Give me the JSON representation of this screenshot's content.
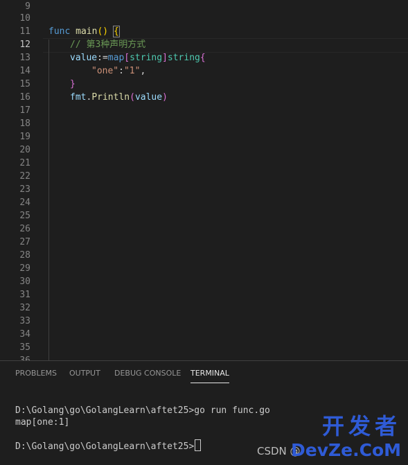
{
  "editor": {
    "line_numbers": [
      "9",
      "10",
      "11",
      "12",
      "13",
      "14",
      "15",
      "16",
      "17",
      "18",
      "19",
      "20",
      "21",
      "22",
      "23",
      "24",
      "25",
      "26",
      "27",
      "28",
      "29",
      "30",
      "31",
      "32",
      "33",
      "34",
      "35",
      "36"
    ],
    "current_line": "12",
    "code": {
      "l11": {
        "kw": "func",
        "fn": "main",
        "paren_open": "(",
        "paren_close": ")",
        "space": " ",
        "brace_open": "{"
      },
      "l12": {
        "comment": "// 第3种声明方式"
      },
      "l13": {
        "var": "value",
        "op": ":=",
        "kw": "map",
        "bo": "[",
        "t1": "string",
        "bc": "]",
        "t2": "string",
        "brace": "{"
      },
      "l14": {
        "s1": "\"one\"",
        "colon": ":",
        "s2": "\"1\"",
        "comma": ","
      },
      "l15": {
        "brace": "}"
      },
      "l16": {
        "pkg": "fmt",
        "dot": ".",
        "fn": "Println",
        "po": "(",
        "arg": "value",
        "pc": ")"
      }
    }
  },
  "panel": {
    "tabs": [
      "PROBLEMS",
      "OUTPUT",
      "DEBUG CONSOLE",
      "TERMINAL"
    ],
    "active_tab": "TERMINAL",
    "terminal_lines": [
      "D:\\Golang\\go\\GolangLearn\\aftet25>go run func.go",
      "map[one:1]",
      "",
      "D:\\Golang\\go\\GolangLearn\\aftet25>"
    ]
  },
  "watermark": {
    "big": "开发者",
    "csdn": "CSDN @",
    "devze": "DevZe.CoM"
  }
}
